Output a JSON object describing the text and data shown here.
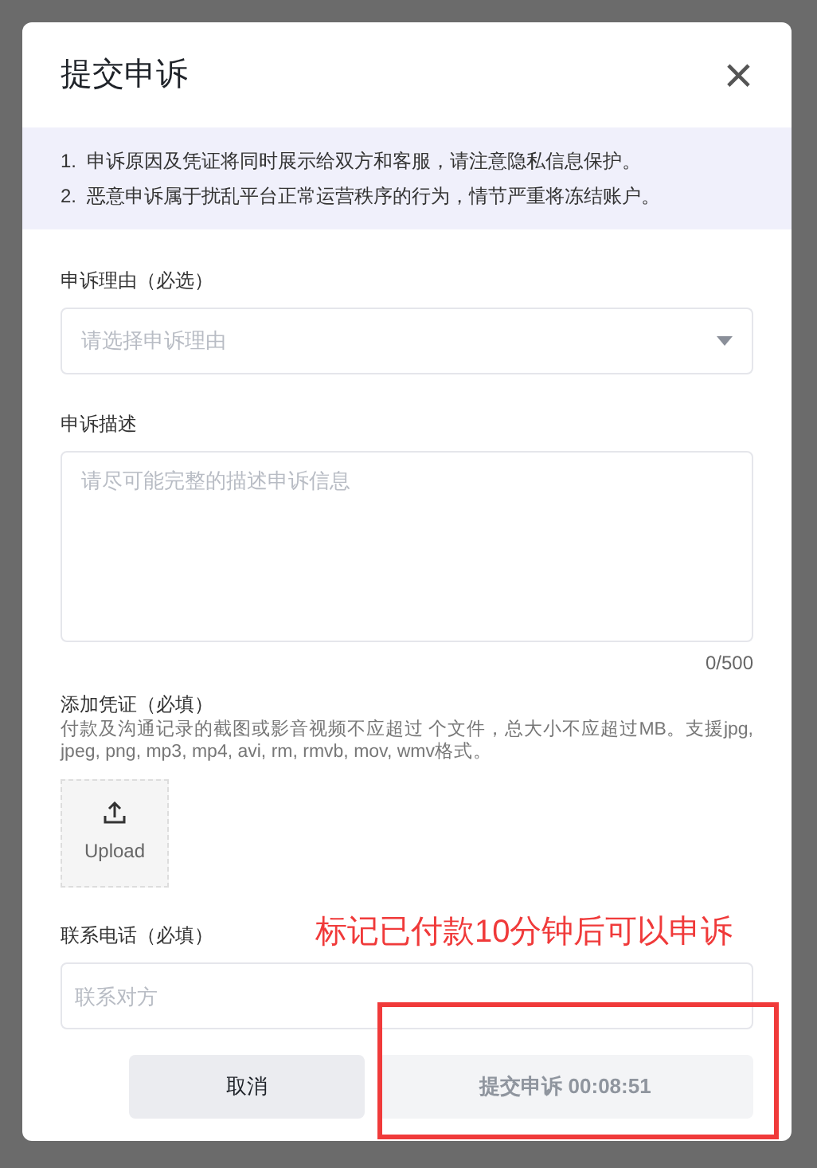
{
  "dialog": {
    "title": "提交申诉",
    "close": "×"
  },
  "notices": [
    "1.  申诉原因及凭证将同时展示给双方和客服，请注意隐私信息保护。",
    "2.  恶意申诉属于扰乱平台正常运营秩序的行为，情节严重将冻结账户。"
  ],
  "reason": {
    "label": "申诉理由（必选）",
    "placeholder": "请选择申诉理由"
  },
  "description": {
    "label": "申诉描述",
    "placeholder": "请尽可能完整的描述申诉信息",
    "counter": "0/500"
  },
  "evidence": {
    "label": "添加凭证（必填）",
    "hint": "付款及沟通记录的截图或影音视频不应超过 个文件，总大小不应超过MB。支援jpg, jpeg, png, mp3, mp4, avi, rm, rmvb, mov, wmv格式。",
    "upload": "Upload"
  },
  "phone": {
    "label": "联系电话（必填）",
    "placeholder": "联系对方"
  },
  "buttons": [
    {
      "kind": "cancel",
      "label": "取消"
    },
    {
      "kind": "submit",
      "label": "提交申诉 00:08:51",
      "disabled": true
    }
  ],
  "annotation": {
    "text": "标记已付款10分钟后可以申诉"
  }
}
